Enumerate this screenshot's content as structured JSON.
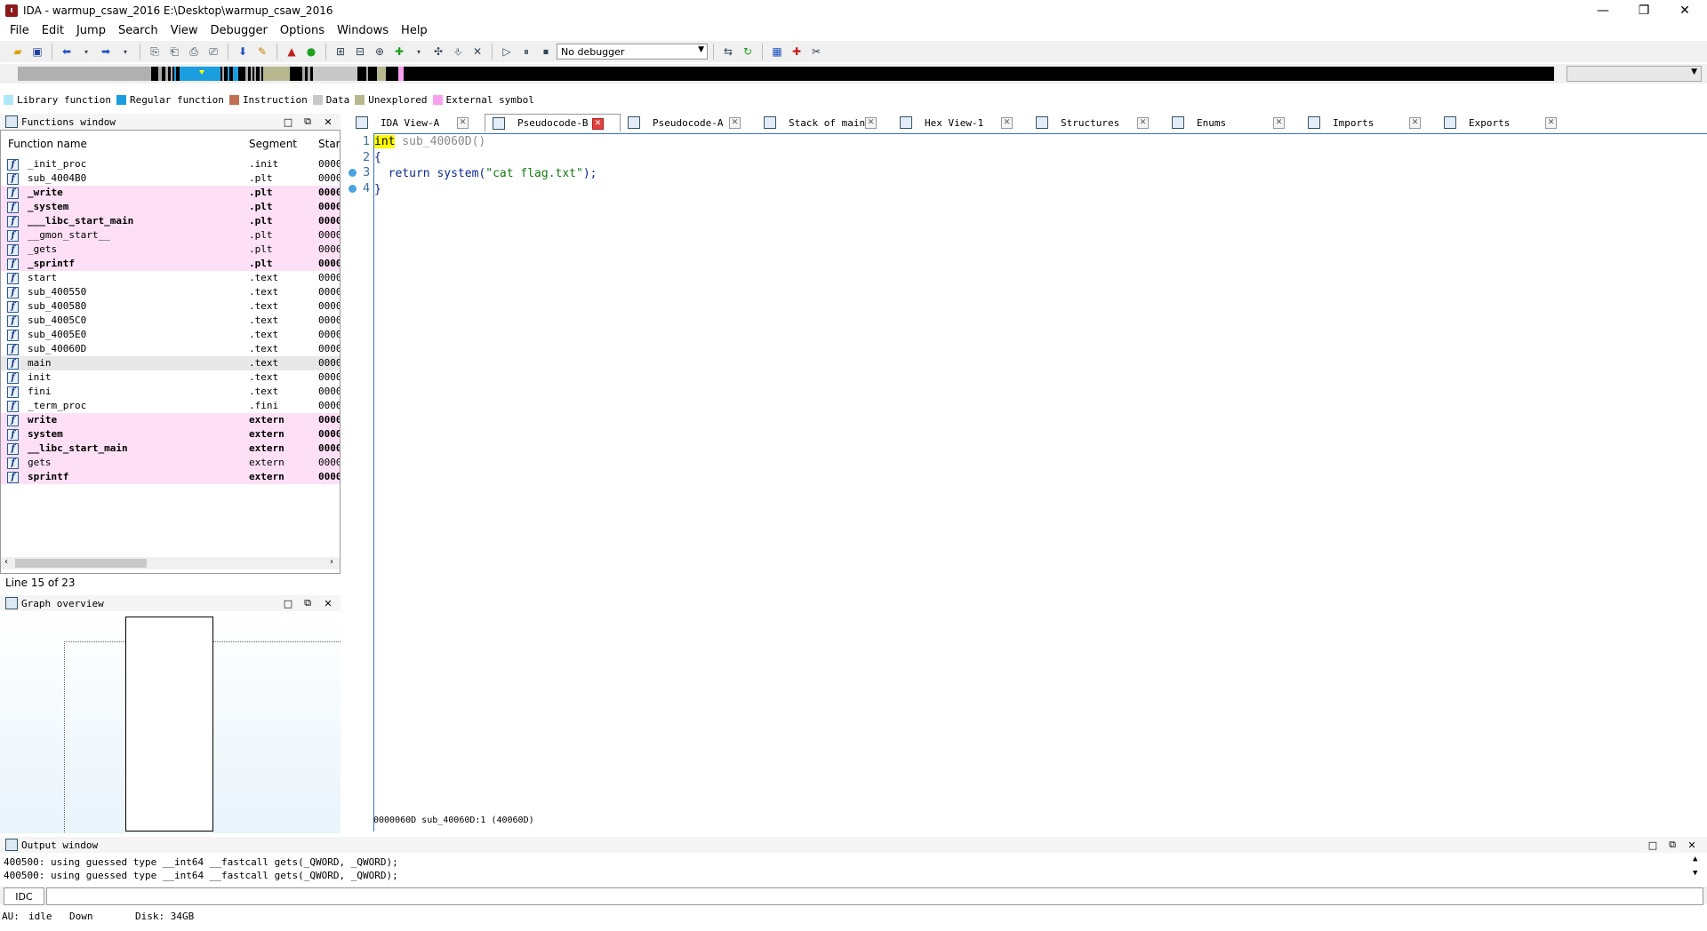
{
  "window": {
    "title": "IDA - warmup_csaw_2016 E:\\Desktop\\warmup_csaw_2016"
  },
  "menu": [
    "File",
    "Edit",
    "Jump",
    "Search",
    "View",
    "Debugger",
    "Options",
    "Windows",
    "Help"
  ],
  "toolbar": {
    "debugger_select": "No debugger"
  },
  "legend": [
    {
      "label": "Library function",
      "color": "#aee8f8"
    },
    {
      "label": "Regular function",
      "color": "#1a9ee0"
    },
    {
      "label": "Instruction",
      "color": "#c07050"
    },
    {
      "label": "Data",
      "color": "#c8c8c8"
    },
    {
      "label": "Unexplored",
      "color": "#b8b890"
    },
    {
      "label": "External symbol",
      "color": "#f8a0f0"
    }
  ],
  "functions_window": {
    "title": "Functions window",
    "columns": {
      "name": "Function name",
      "segment": "Segment",
      "start": "Star"
    },
    "rows": [
      {
        "name": "_init_proc",
        "segment": ".init",
        "start": "0000",
        "style": "normal"
      },
      {
        "name": "sub_4004B0",
        "segment": ".plt",
        "start": "0000",
        "style": "normal"
      },
      {
        "name": "_write",
        "segment": ".plt",
        "start": "0000",
        "style": "pinkbold"
      },
      {
        "name": "_system",
        "segment": ".plt",
        "start": "0000",
        "style": "pinkbold"
      },
      {
        "name": "___libc_start_main",
        "segment": ".plt",
        "start": "0000",
        "style": "pinkbold"
      },
      {
        "name": "__gmon_start__",
        "segment": ".plt",
        "start": "0000",
        "style": "pink"
      },
      {
        "name": "_gets",
        "segment": ".plt",
        "start": "0000",
        "style": "pink"
      },
      {
        "name": "_sprintf",
        "segment": ".plt",
        "start": "0000",
        "style": "pinkbold"
      },
      {
        "name": "start",
        "segment": ".text",
        "start": "0000",
        "style": "normal"
      },
      {
        "name": "sub_400550",
        "segment": ".text",
        "start": "0000",
        "style": "normal"
      },
      {
        "name": "sub_400580",
        "segment": ".text",
        "start": "0000",
        "style": "normal"
      },
      {
        "name": "sub_4005C0",
        "segment": ".text",
        "start": "0000",
        "style": "normal"
      },
      {
        "name": "sub_4005E0",
        "segment": ".text",
        "start": "0000",
        "style": "normal"
      },
      {
        "name": "sub_40060D",
        "segment": ".text",
        "start": "0000",
        "style": "normal"
      },
      {
        "name": "main",
        "segment": ".text",
        "start": "0000",
        "style": "sel"
      },
      {
        "name": "init",
        "segment": ".text",
        "start": "0000",
        "style": "normal"
      },
      {
        "name": "fini",
        "segment": ".text",
        "start": "0000",
        "style": "normal"
      },
      {
        "name": "_term_proc",
        "segment": ".fini",
        "start": "0000",
        "style": "normal"
      },
      {
        "name": "write",
        "segment": "extern",
        "start": "0000",
        "style": "pinkbold"
      },
      {
        "name": "system",
        "segment": "extern",
        "start": "0000",
        "style": "pinkbold"
      },
      {
        "name": "__libc_start_main",
        "segment": "extern",
        "start": "0000",
        "style": "pinkbold"
      },
      {
        "name": "gets",
        "segment": "extern",
        "start": "0000",
        "style": "pink"
      },
      {
        "name": "sprintf",
        "segment": "extern",
        "start": "0000",
        "style": "pinkbold"
      }
    ],
    "line_count": "Line 15 of 23"
  },
  "graph_overview": {
    "title": "Graph overview"
  },
  "tabs": [
    {
      "label": "IDA View-A",
      "active": false
    },
    {
      "label": "Pseudocode-B",
      "active": true
    },
    {
      "label": "Pseudocode-A",
      "active": false
    },
    {
      "label": "Stack of main",
      "active": false
    },
    {
      "label": "Hex View-1",
      "active": false
    },
    {
      "label": "Structures",
      "active": false
    },
    {
      "label": "Enums",
      "active": false
    },
    {
      "label": "Imports",
      "active": false
    },
    {
      "label": "Exports",
      "active": false
    }
  ],
  "code": {
    "lines": [
      "1",
      "2",
      "3",
      "4"
    ],
    "l1_kw": "int",
    "l1_rest": " sub_40060D()",
    "l2": "{",
    "l3_kw": "  return ",
    "l3_fn": "system",
    "l3_open": "(",
    "l3_str": "\"cat flag.txt\"",
    "l3_close": ");",
    "l4": "}",
    "status": "0000060D sub_40060D:1 (40060D)"
  },
  "output": {
    "title": "Output window",
    "lines": [
      "400500: using guessed type __int64 __fastcall gets(_QWORD, _QWORD);",
      "400500: using guessed type __int64 __fastcall gets(_QWORD, _QWORD);"
    ],
    "idc_label": "IDC"
  },
  "status": {
    "au": "AU:",
    "state": "idle",
    "dir": "Down",
    "disk": "Disk: 34GB"
  }
}
